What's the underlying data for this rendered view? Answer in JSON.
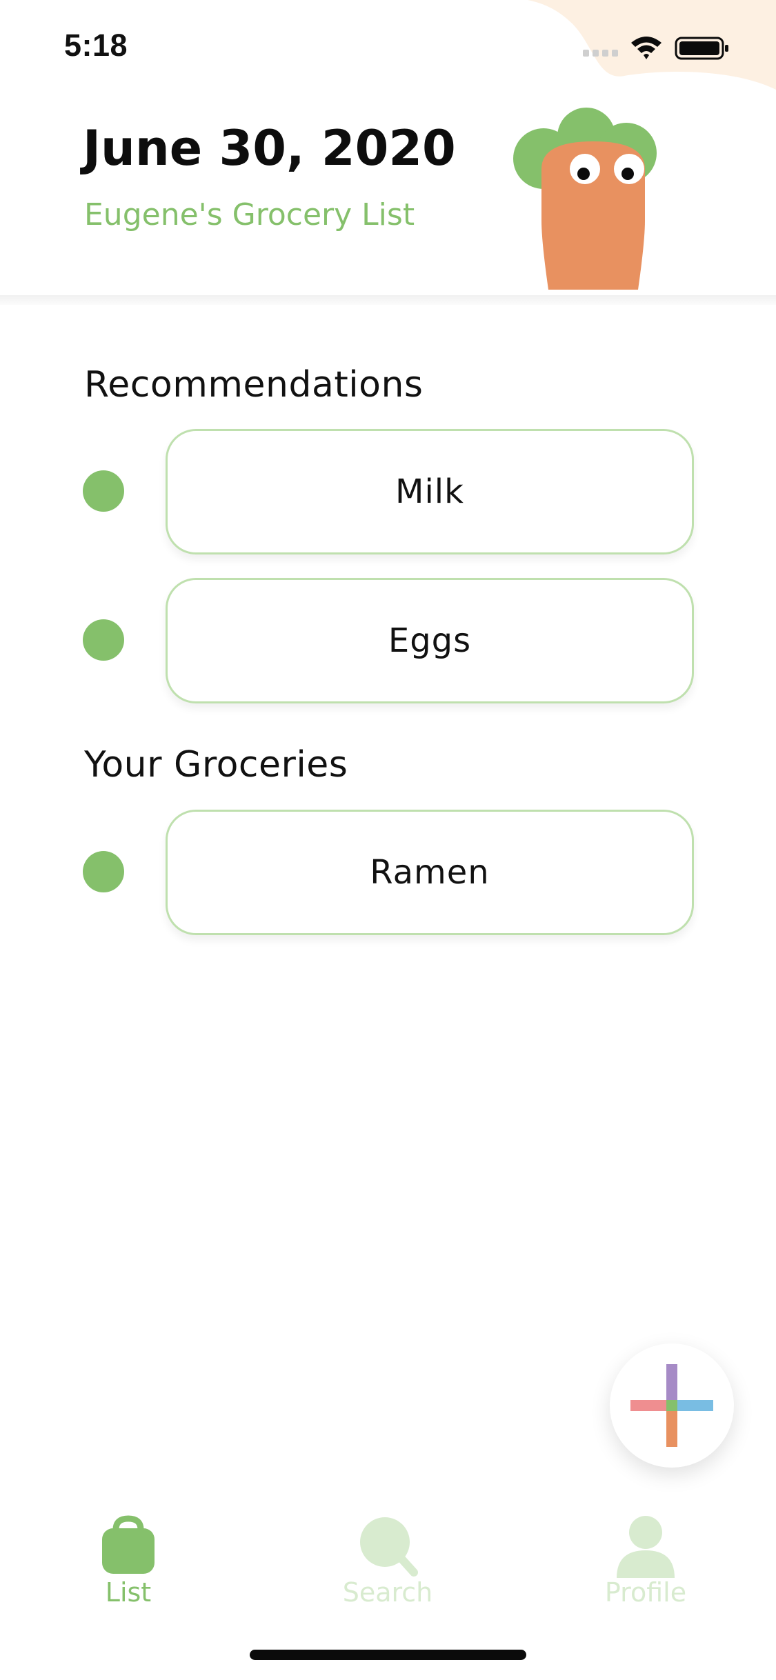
{
  "status_bar": {
    "time": "5:18"
  },
  "header": {
    "date": "June 30, 2020",
    "subtitle": "Eugene's Grocery List"
  },
  "sections": {
    "recommendations": {
      "title": "Recommendations",
      "items": [
        {
          "label": "Milk"
        },
        {
          "label": "Eggs"
        }
      ]
    },
    "your_groceries": {
      "title": "Your Groceries",
      "items": [
        {
          "label": "Ramen"
        }
      ]
    }
  },
  "tab_bar": {
    "tabs": [
      {
        "label": "List",
        "icon": "bag-icon",
        "active": true
      },
      {
        "label": "Search",
        "icon": "search-icon",
        "active": false
      },
      {
        "label": "Profile",
        "icon": "profile-icon",
        "active": false
      }
    ]
  },
  "fab": {
    "icon": "plus-icon"
  },
  "colors": {
    "accent_green": "#85c06b",
    "light_green_border": "#bfe0ae",
    "inactive_green": "#d8ebcf",
    "carrot_orange": "#e89160",
    "corner_blob": "#fdf0e2",
    "plus_red": "#ef8e90",
    "plus_blue": "#79bde3",
    "plus_purple": "#a68bc6",
    "plus_orange": "#e89160"
  }
}
